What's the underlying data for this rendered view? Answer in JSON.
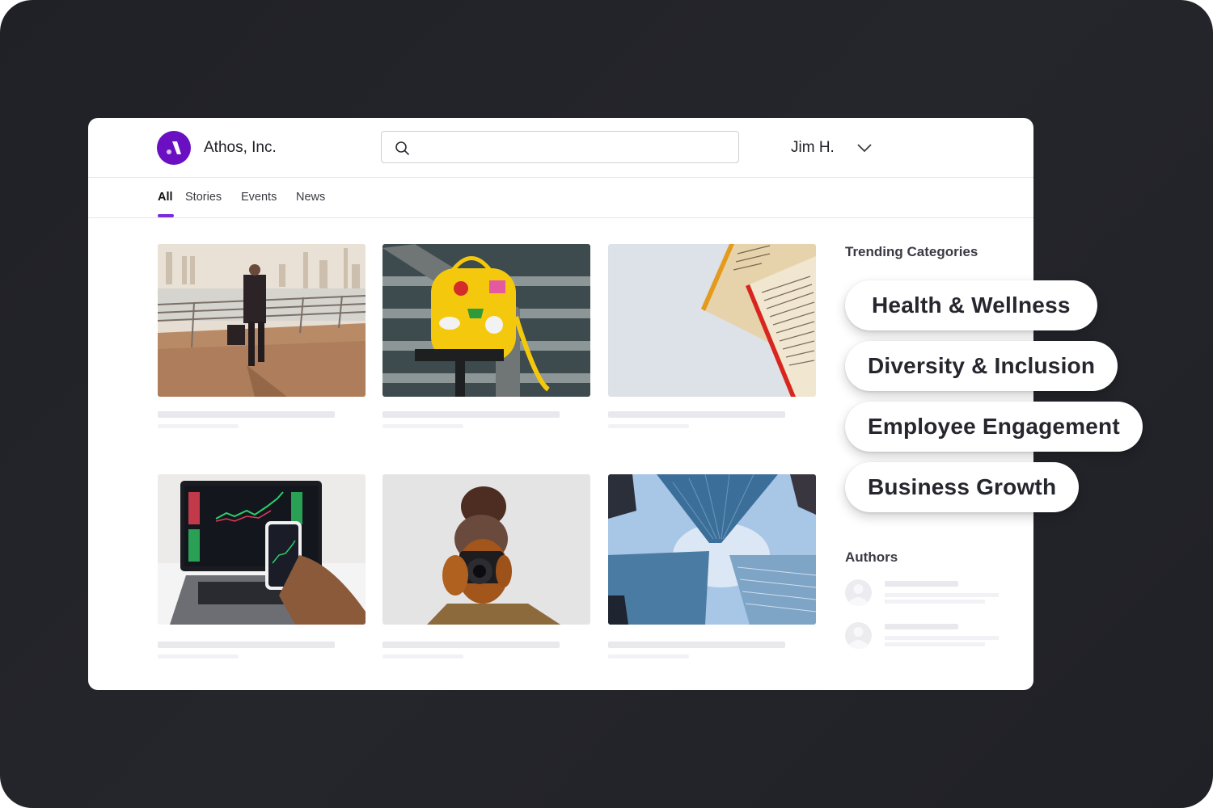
{
  "app": {
    "brand_name": "Athos, Inc.",
    "brand_color": "#6a0fc2",
    "accent_color": "#7b2ae0"
  },
  "header": {
    "search_placeholder": "",
    "search_value": "",
    "user_name": "Jim H.",
    "icons": {
      "search": "search-icon",
      "user_menu": "chevron-down-icon",
      "logo": "athos-logo-icon"
    }
  },
  "tabs": [
    {
      "label": "All",
      "active": true
    },
    {
      "label": "Stories",
      "active": false
    },
    {
      "label": "Events",
      "active": false
    },
    {
      "label": "News",
      "active": false
    }
  ],
  "feed": {
    "cards": [
      {
        "image": "man-in-suit-walking-waterfront",
        "title": "",
        "meta": ""
      },
      {
        "image": "yellow-backpack-with-patches",
        "title": "",
        "meta": ""
      },
      {
        "image": "open-books-on-table",
        "title": "",
        "meta": ""
      },
      {
        "image": "laptop-and-phone-stock-charts",
        "title": "",
        "meta": ""
      },
      {
        "image": "woman-with-camera",
        "title": "",
        "meta": ""
      },
      {
        "image": "skyscrapers-looking-up",
        "title": "",
        "meta": ""
      }
    ]
  },
  "sidebar": {
    "trending_heading": "Trending Categories",
    "categories": [
      "Health & Wellness",
      "Diversity & Inclusion",
      "Employee Engagement",
      "Business Growth"
    ],
    "authors_heading": "Authors",
    "authors": [
      {
        "name": "",
        "bio": ""
      },
      {
        "name": "",
        "bio": ""
      }
    ]
  }
}
